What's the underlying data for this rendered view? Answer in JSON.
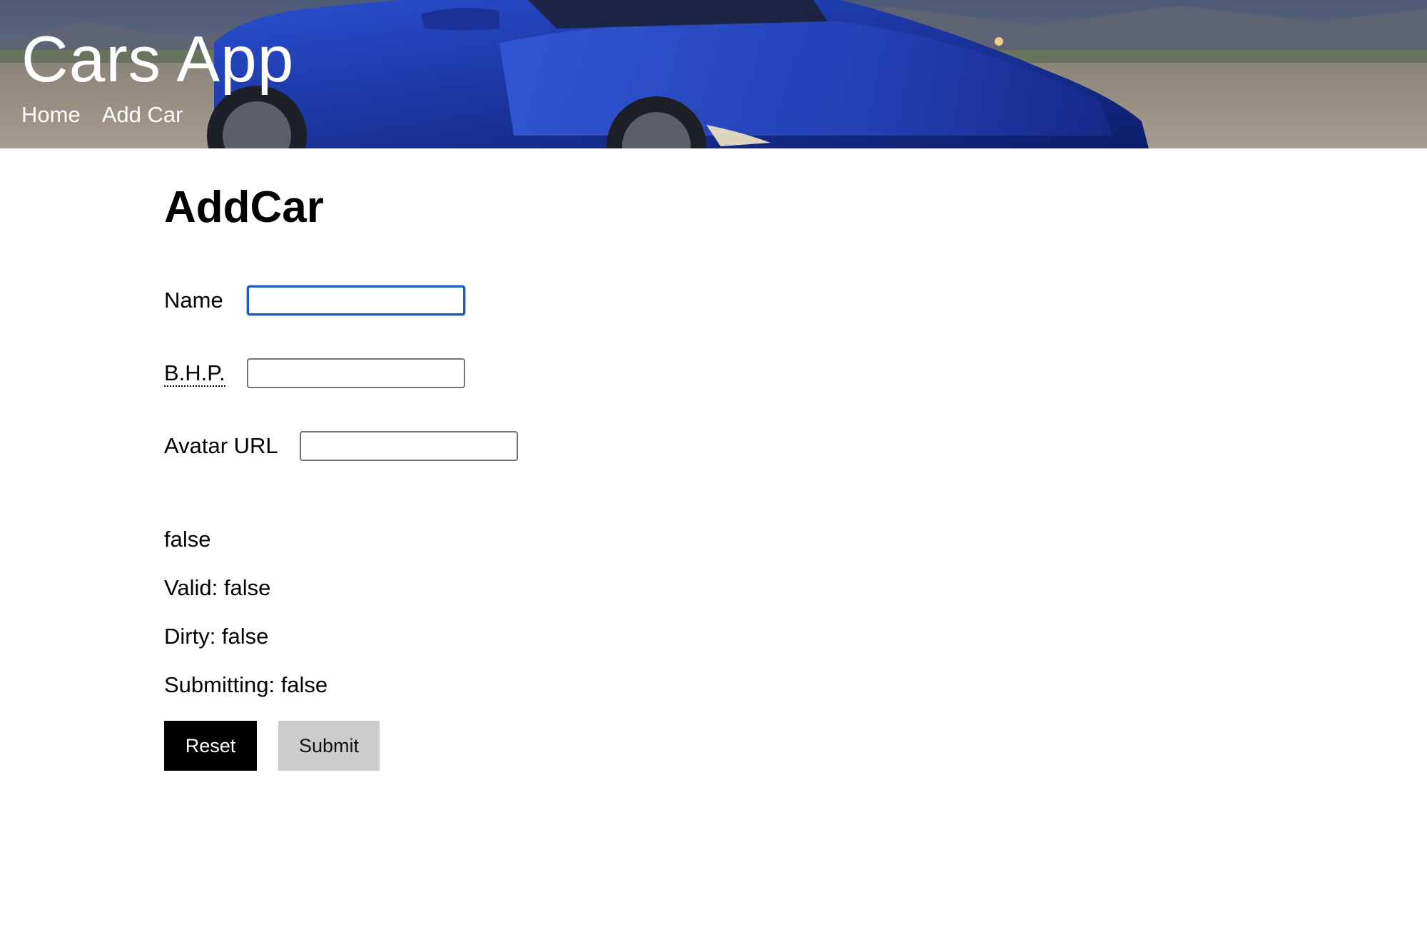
{
  "header": {
    "brand": "Cars App",
    "nav": [
      {
        "label": "Home"
      },
      {
        "label": "Add Car"
      }
    ]
  },
  "main": {
    "title": "AddCar",
    "fields": {
      "name": {
        "label": "Name",
        "value": ""
      },
      "bhp": {
        "label": "B.H.P.",
        "value": ""
      },
      "avatar": {
        "label": "Avatar URL",
        "value": ""
      }
    },
    "status": {
      "flag": "false",
      "valid": "Valid: false",
      "dirty": "Dirty: false",
      "submitting": "Submitting: false"
    },
    "buttons": {
      "reset": "Reset",
      "submit": "Submit"
    }
  },
  "colors": {
    "focus_ring": "#1f5bbf",
    "car_blue": "#1c3aa0",
    "reset_bg": "#000000",
    "submit_bg": "#cccccc"
  }
}
